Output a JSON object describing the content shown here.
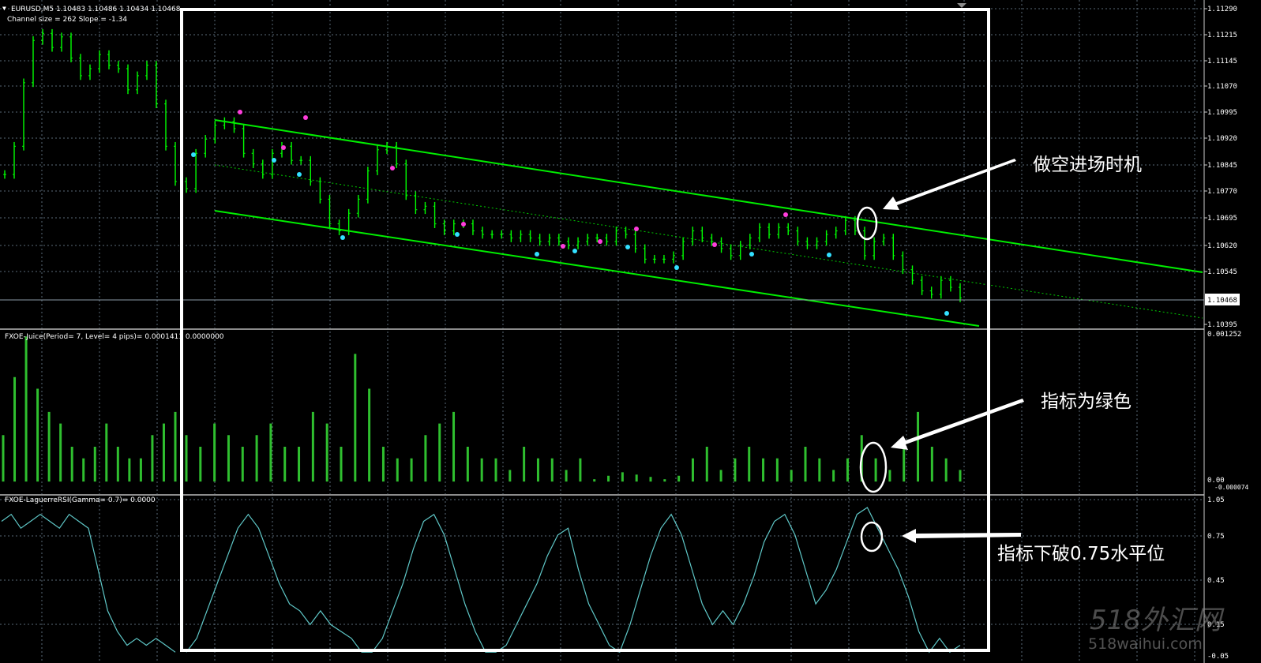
{
  "chart_header": {
    "symbol_line": "EURUSD,M5  1.10483 1.10486 1.10434 1.10468",
    "channel_info": "Channel size = 262 Slope = -1.34"
  },
  "price_axis": {
    "ticks": [
      "1.11290",
      "1.11215",
      "1.11145",
      "1.11070",
      "1.10995",
      "1.10920",
      "1.10845",
      "1.10770",
      "1.10695",
      "1.10620",
      "1.10545",
      "1.10468",
      "1.10395"
    ],
    "current_price": "1.10468"
  },
  "juice_panel": {
    "label": "FXOE-Juice(Period= 7, Level= 4 pips)=  0.0001411  0.0000000",
    "axis_top": "0.001252",
    "axis_bottom": "0.00",
    "axis_bottom2": "-0.000074"
  },
  "rsi_panel": {
    "label": "FXOE-LaguerreRSI(Gamma= 0.7)=  0.0000",
    "axis_ticks": [
      "1.05",
      "0.75",
      "0.45",
      "0.15"
    ],
    "axis_bottom": "-0.05"
  },
  "annotations": {
    "short_entry": "做空进场时机",
    "indicator_green": "指标为绿色",
    "break_level": "指标下破0.75水平位"
  },
  "watermark": {
    "line1": "518外汇网",
    "line2": "518waihui.com"
  },
  "colors": {
    "background": "#000000",
    "price_bars": "#00ff00",
    "channel": "#00ee00",
    "juice_bars": "#2fbf2f",
    "rsi_line": "#5fc8c8",
    "grid": "#5a6a78",
    "annotation": "#ffffff",
    "dot_magenta": "#ff3ddc",
    "dot_cyan": "#33e0ff"
  },
  "chart_data": [
    {
      "type": "line",
      "title": "EURUSD,M5",
      "series": [
        {
          "values": [
            1.1082,
            1.109,
            1.1108,
            1.112,
            1.1122,
            1.1118,
            1.1121,
            1.1115,
            1.111,
            1.1112,
            1.1116,
            1.1113,
            1.1112,
            1.1106,
            1.111,
            1.1113,
            1.1102,
            1.109,
            1.108,
            1.1078,
            1.1088,
            1.1092,
            1.1096,
            1.1097,
            1.1095,
            1.1088,
            1.1085,
            1.1082,
            1.1088,
            1.109,
            1.1086,
            1.1086,
            1.108,
            1.1075,
            1.1068,
            1.1066,
            1.1071,
            1.1075,
            1.1083,
            1.1089,
            1.109,
            1.1085,
            1.1076,
            1.1072,
            1.1073,
            1.1068,
            1.1066,
            1.1068,
            1.1068,
            1.1066,
            1.1065,
            1.1065,
            1.1065,
            1.1064,
            1.1065,
            1.1064,
            1.1063,
            1.1064,
            1.1063,
            1.1062,
            1.1063,
            1.1064,
            1.1064,
            1.1063,
            1.1066,
            1.1065,
            1.1061,
            1.1058,
            1.1058,
            1.1058,
            1.1059,
            1.1063,
            1.1066,
            1.1064,
            1.1063,
            1.1061,
            1.1059,
            1.1062,
            1.1064,
            1.1067,
            1.1065,
            1.1067,
            1.1066,
            1.1063,
            1.1062,
            1.1063,
            1.1065,
            1.1066,
            1.1069,
            1.1066,
            1.1059,
            1.1063,
            1.1064,
            1.1059,
            1.1055,
            1.1052,
            1.1049,
            1.1048,
            1.1052,
            1.105,
            1.1047
          ]
        }
      ]
    },
    {
      "type": "bar",
      "title": "FXOE-Juice(Period= 7, Level= 4 pips)",
      "ylim": [
        -7.4e-05,
        0.001252
      ],
      "values": [
        0.0004,
        0.0009,
        0.00125,
        0.0008,
        0.0006,
        0.0005,
        0.0003,
        0.0002,
        0.0003,
        0.0005,
        0.0003,
        0.0002,
        0.0002,
        0.0004,
        0.0005,
        0.0006,
        0.0004,
        0.0003,
        0.0005,
        0.0004,
        0.0003,
        0.0004,
        0.0005,
        0.0003,
        0.0003,
        0.0006,
        0.0005,
        0.0003,
        0.0011,
        0.0008,
        0.0003,
        0.0002,
        0.0002,
        0.0004,
        0.0005,
        0.0006,
        0.0003,
        0.0002,
        0.0002,
        0.0001,
        0.0003,
        0.0002,
        0.0002,
        0.0001,
        0.0002,
        2e-05,
        5e-05,
        8e-05,
        6e-05,
        4e-05,
        2e-05,
        5e-05,
        0.0002,
        0.0003,
        0.0001,
        0.0002,
        0.0003,
        0.0002,
        0.0002,
        0.0001,
        0.0003,
        0.0002,
        0.0001,
        0.0002,
        0.0004,
        0.0002,
        0.0001,
        0.0003,
        0.0006,
        0.0003,
        0.0002,
        0.0001
      ]
    },
    {
      "type": "line",
      "title": "FXOE-LaguerreRSI(Gamma= 0.7)",
      "ylim": [
        -0.05,
        1.05
      ],
      "series": [
        {
          "values": [
            0.95,
            1.0,
            0.9,
            0.95,
            1.0,
            0.95,
            0.9,
            1.0,
            0.95,
            0.9,
            0.6,
            0.3,
            0.15,
            0.05,
            0.1,
            0.05,
            0.1,
            0.05,
            0.0,
            0.0,
            0.1,
            0.3,
            0.5,
            0.7,
            0.9,
            1.0,
            0.9,
            0.7,
            0.5,
            0.35,
            0.3,
            0.2,
            0.3,
            0.2,
            0.15,
            0.1,
            0.0,
            0.0,
            0.1,
            0.3,
            0.5,
            0.75,
            0.95,
            1.0,
            0.85,
            0.6,
            0.35,
            0.15,
            0.0,
            0.0,
            0.05,
            0.2,
            0.35,
            0.5,
            0.7,
            0.85,
            0.9,
            0.6,
            0.35,
            0.2,
            0.05,
            0.0,
            0.2,
            0.45,
            0.7,
            0.9,
            1.0,
            0.85,
            0.6,
            0.35,
            0.2,
            0.3,
            0.2,
            0.35,
            0.55,
            0.8,
            0.95,
            1.0,
            0.85,
            0.6,
            0.35,
            0.45,
            0.6,
            0.8,
            1.0,
            1.05,
            0.9,
            0.75,
            0.6,
            0.4,
            0.15,
            0.0,
            0.1,
            0.0,
            0.05
          ]
        }
      ]
    }
  ]
}
